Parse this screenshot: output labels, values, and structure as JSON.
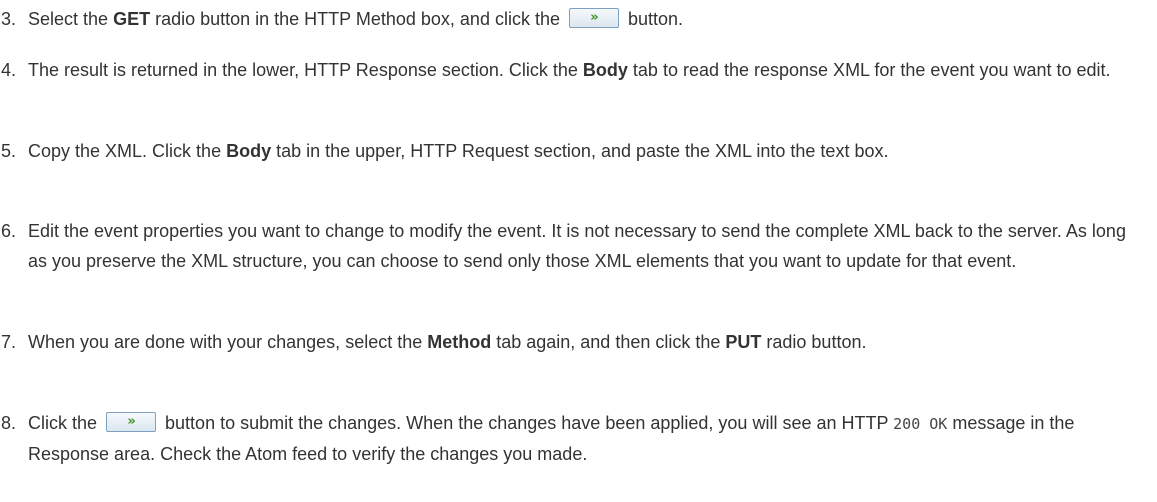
{
  "steps": [
    {
      "num": "3.",
      "parts": [
        {
          "t": "text",
          "v": "Select the "
        },
        {
          "t": "bold",
          "v": "GET"
        },
        {
          "t": "text",
          "v": " radio button in the HTTP Method box, and click the "
        },
        {
          "t": "button",
          "icon": "double-chevron-right-icon",
          "glyph": "»"
        },
        {
          "t": "text",
          "v": " button."
        }
      ]
    },
    {
      "num": "4.",
      "parts": [
        {
          "t": "text",
          "v": "The result is returned in the lower, HTTP Response section. Click the "
        },
        {
          "t": "bold",
          "v": "Body"
        },
        {
          "t": "text",
          "v": " tab to read the response XML for the event you want to edit."
        }
      ]
    },
    {
      "num": "5.",
      "parts": [
        {
          "t": "text",
          "v": "Copy the XML. Click the "
        },
        {
          "t": "bold",
          "v": "Body"
        },
        {
          "t": "text",
          "v": " tab in the upper, HTTP Request section, and paste the XML into the text box."
        }
      ]
    },
    {
      "num": "6.",
      "parts": [
        {
          "t": "text",
          "v": "Edit the event properties you want to change to modify the event. It is not necessary to send the complete XML back to the server. As long as you preserve the XML structure, you can choose to send only those XML elements that you want to update for that event."
        }
      ]
    },
    {
      "num": "7.",
      "parts": [
        {
          "t": "text",
          "v": "When you are done with your changes, select the "
        },
        {
          "t": "bold",
          "v": "Method"
        },
        {
          "t": "text",
          "v": " tab again, and then click the "
        },
        {
          "t": "bold",
          "v": "PUT"
        },
        {
          "t": "text",
          "v": " radio button."
        }
      ]
    },
    {
      "num": "8.",
      "parts": [
        {
          "t": "text",
          "v": "Click the "
        },
        {
          "t": "button",
          "icon": "double-chevron-right-icon",
          "glyph": "»"
        },
        {
          "t": "text",
          "v": " button to submit the changes. When the changes have been applied, you will see an HTTP "
        },
        {
          "t": "code",
          "v": "200 OK"
        },
        {
          "t": "text",
          "v": " message in the Response area. Check the Atom feed to verify the changes you made."
        }
      ]
    }
  ]
}
